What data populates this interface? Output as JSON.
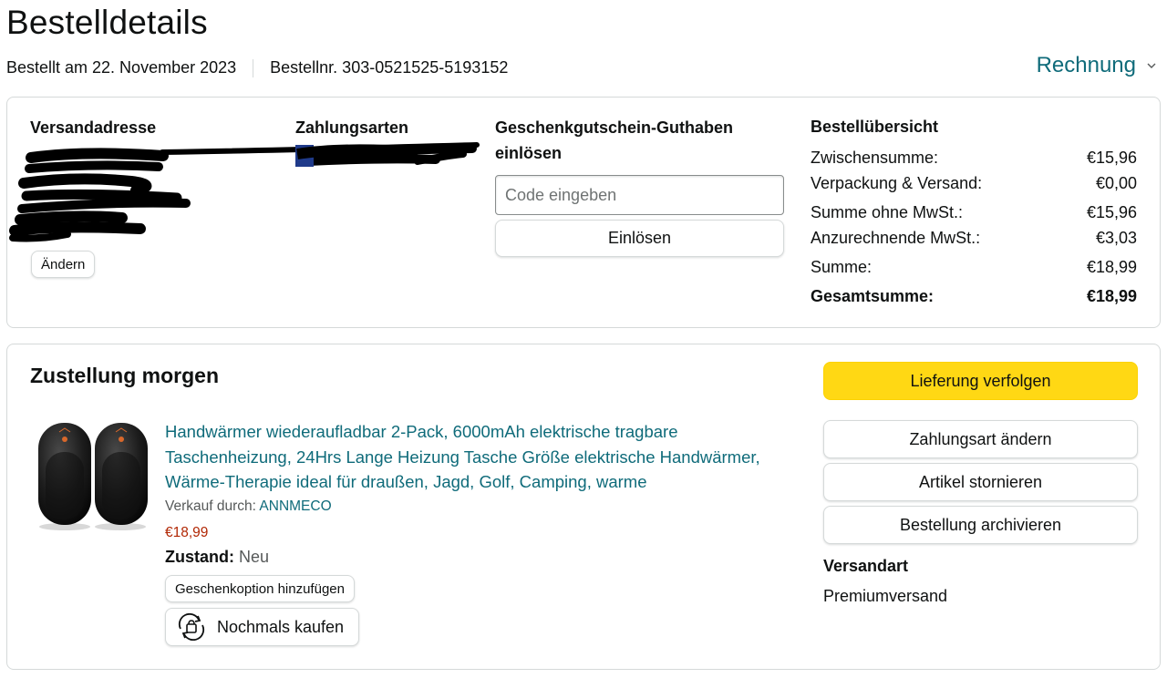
{
  "page": {
    "title": "Bestelldetails",
    "order_date": "Bestellt am 22. November 2023",
    "order_number": "Bestellnr. 303-0521525-5193152",
    "invoice_label": "Rechnung"
  },
  "shipping_address": {
    "heading": "Versandadresse",
    "change_label": "Ändern"
  },
  "payment": {
    "heading": "Zahlungsarten"
  },
  "gift_card": {
    "heading_line1": "Geschenkgutschein-Guthaben",
    "heading_line2": "einlösen",
    "placeholder": "Code eingeben",
    "redeem_label": "Einlösen"
  },
  "order_summary": {
    "heading": "Bestellübersicht",
    "rows": [
      {
        "label": "Zwischensumme:",
        "value": "€15,96"
      },
      {
        "label": "Verpackung & Versand:",
        "value": "€0,00"
      },
      {
        "label": "Summe ohne MwSt.:",
        "value": "€15,96"
      },
      {
        "label": "Anzurechnende MwSt.:",
        "value": "€3,03"
      },
      {
        "label": "Summe:",
        "value": "€18,99"
      }
    ],
    "total_label": "Gesamtsumme:",
    "total_value": "€18,99"
  },
  "delivery": {
    "heading": "Zustellung morgen",
    "product_title": "Handwärmer wiederaufladbar 2-Pack, 6000mAh elektrische tragbare Taschenheizung, 24Hrs Lange Heizung Tasche Größe elektrische Handwärmer, Wärme-Therapie ideal für draußen, Jagd, Golf, Camping, warme",
    "seller_prefix": "Verkauf durch:",
    "seller_name": "ANNMECO",
    "price": "€18,99",
    "condition_label": "Zustand:",
    "condition_value": "Neu",
    "gift_option_label": "Geschenkoption hinzufügen",
    "buy_again_label": "Nochmals kaufen"
  },
  "actions": {
    "track": "Lieferung verfolgen",
    "change_payment": "Zahlungsart ändern",
    "cancel": "Artikel stornieren",
    "archive": "Bestellung archivieren"
  },
  "shipping_method": {
    "label": "Versandart",
    "value": "Premiumversand"
  },
  "colors": {
    "link": "#0f6b7a",
    "price": "#b12704",
    "primary_button": "#ffd814",
    "border": "#d5d9d9"
  }
}
